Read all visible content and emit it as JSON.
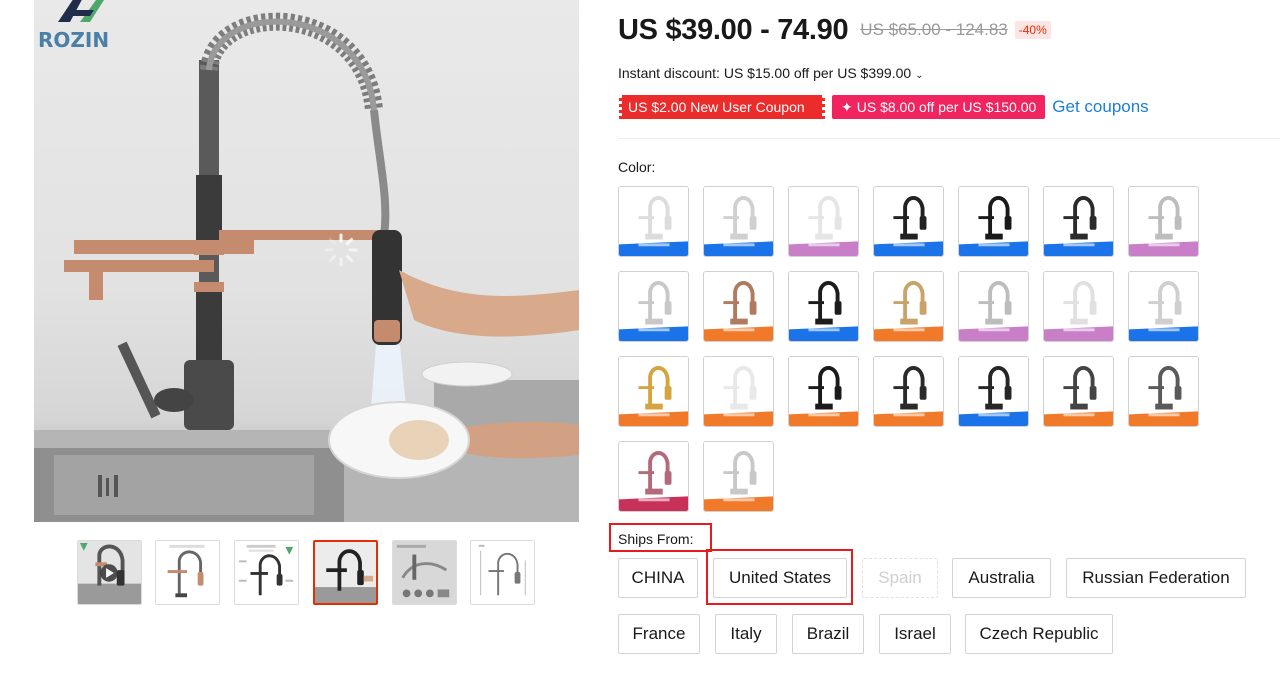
{
  "gallery": {
    "brand": "ROZIN",
    "thumbnails": [
      {
        "name": "video-thumbnail",
        "has_play": true
      },
      {
        "name": "rose-gold-faucet-thumbnail"
      },
      {
        "name": "faucet-diagram-thumbnail"
      },
      {
        "name": "black-faucet-thumbnail",
        "selected": true
      },
      {
        "name": "accessories-thumbnail"
      },
      {
        "name": "dimensions-thumbnail"
      }
    ]
  },
  "price": {
    "current": "US $39.00 - 74.90",
    "original": "US $65.00 - 124.83",
    "discount": "-40%"
  },
  "instant_discount": "Instant discount: US $15.00 off per US $399.00",
  "coupons": {
    "new_user": "US $2.00 New User Coupon",
    "store": "US $8.00 off per US $150.00",
    "store_icon": "✦",
    "get_coupons": "Get coupons"
  },
  "color": {
    "label": "Color:",
    "swatches": [
      {
        "body": "#dcdcdc",
        "accent": "#1a73e8"
      },
      {
        "body": "#d0d0d0",
        "accent": "#1a73e8"
      },
      {
        "body": "#e5e5e5",
        "accent": "#c87fc8"
      },
      {
        "body": "#222222",
        "accent": "#1a73e8"
      },
      {
        "body": "#1a1a1a",
        "accent": "#1a73e8"
      },
      {
        "body": "#2b2b2b",
        "accent": "#1a73e8"
      },
      {
        "body": "#bdbdbd",
        "accent": "#c87fc8"
      },
      {
        "body": "#c8c8c8",
        "accent": "#1a73e8"
      },
      {
        "body": "#b07a5e",
        "accent": "#f07a2a"
      },
      {
        "body": "#1c1c1c",
        "accent": "#1a73e8"
      },
      {
        "body": "#c9a36a",
        "accent": "#f07a2a"
      },
      {
        "body": "#bdbdbd",
        "accent": "#c87fc8"
      },
      {
        "body": "#e0e0e0",
        "accent": "#c87fc8"
      },
      {
        "body": "#cfcfcf",
        "accent": "#1a73e8"
      },
      {
        "body": "#d4a440",
        "accent": "#f07a2a"
      },
      {
        "body": "#e8e8e8",
        "accent": "#f07a2a"
      },
      {
        "body": "#1a1a1a",
        "accent": "#f07a2a"
      },
      {
        "body": "#2a2a2a",
        "accent": "#f07a2a"
      },
      {
        "body": "#262626",
        "accent": "#1a73e8"
      },
      {
        "body": "#444444",
        "accent": "#f07a2a"
      },
      {
        "body": "#5a5a5a",
        "accent": "#f07a2a"
      },
      {
        "body": "#b46a7a",
        "accent": "#c8325a"
      },
      {
        "body": "#c8c8c8",
        "accent": "#f07a2a"
      }
    ]
  },
  "ships_from": {
    "label": "Ships From:",
    "options": [
      {
        "label": "CHINA"
      },
      {
        "label": "United States",
        "selected": true
      },
      {
        "label": "Spain",
        "disabled": true
      },
      {
        "label": "Australia"
      },
      {
        "label": "Russian Federation"
      },
      {
        "label": "France"
      },
      {
        "label": "Italy"
      },
      {
        "label": "Brazil"
      },
      {
        "label": "Israel"
      },
      {
        "label": "Czech Republic"
      }
    ]
  },
  "colors": {
    "accent_red": "#e62e04",
    "highlight_red": "#e8191f",
    "coupon_red": "#ec2b2b",
    "coupon_pink": "#f2245f",
    "link_blue": "#1a7fd4"
  }
}
